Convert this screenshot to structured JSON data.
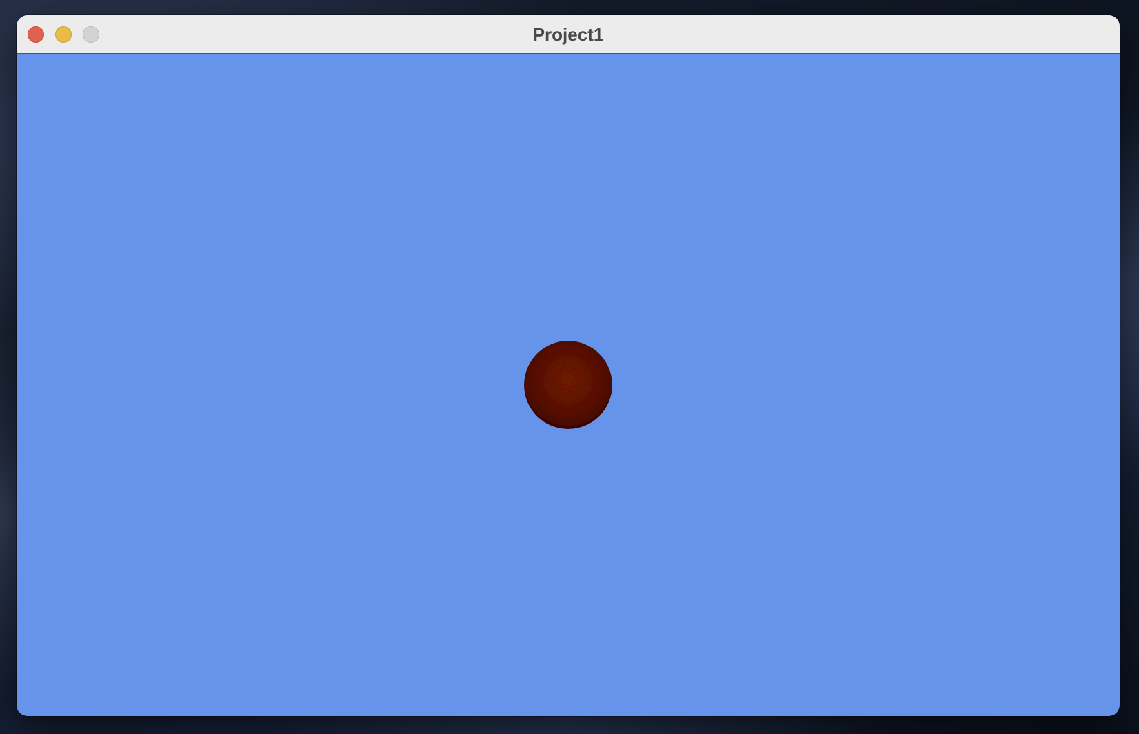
{
  "window": {
    "title": "Project1",
    "background_color": "#6694eb"
  },
  "controls": {
    "close_icon": "close-icon",
    "minimize_icon": "minimize-icon",
    "zoom_icon": "zoom-icon",
    "close_color": "#df6251",
    "minimize_color": "#e7be45",
    "zoom_color": "#d3d3d3"
  },
  "scene": {
    "ball_texture": "leather",
    "ball_color": "#6e1a08"
  }
}
